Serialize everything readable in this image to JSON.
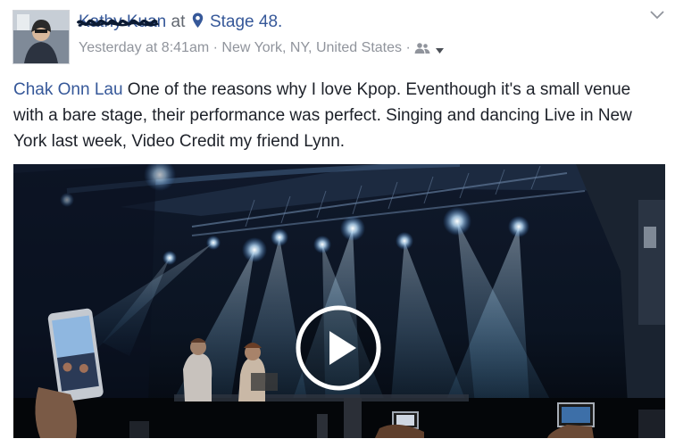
{
  "post": {
    "author_name": "Kathy Kuan",
    "connector": "at",
    "place": "Stage 48.",
    "time": "Yesterday at 8:41am",
    "separator": "·",
    "location": "New York, NY, United States",
    "privacy_icon": "friends-icon",
    "text_tag": "Chak Onn Lau",
    "text_body": " One of the reasons why I love Kpop. Eventhough it's a small venue with a bare stage, their performance was perfect. Singing and dancing Live in New York last week, Video Credit my friend Lynn.",
    "play_icon": "play-icon"
  },
  "colors": {
    "link": "#365899",
    "text": "#1d2129",
    "meta": "#90949c"
  }
}
